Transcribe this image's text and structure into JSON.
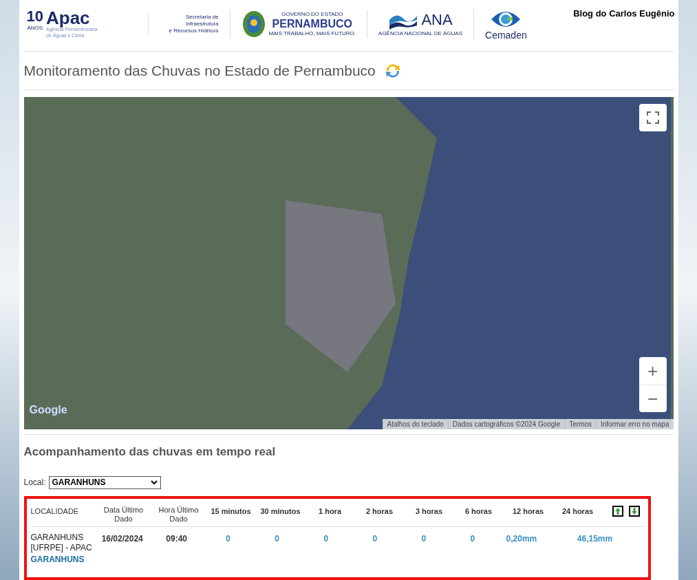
{
  "header": {
    "logos": [
      {
        "kind": "apac",
        "anniversary": "10",
        "anniversary_sub": "ANOS",
        "name": "Apac",
        "subtitle": "Agência Pernambucana de Águas e Clima"
      },
      {
        "kind": "secretaria",
        "lines": [
          "Secretaria de",
          "Infraestrutura",
          "e Recursos Hídricos"
        ]
      },
      {
        "kind": "state",
        "top": "GOVERNO DO ESTADO",
        "name": "PERNAMBUCO",
        "slogan": "MAIS TRABALHO, MAIS FUTURO."
      },
      {
        "kind": "ana",
        "name": "ANA",
        "subtitle": "AGÊNCIA NACIONAL DE ÁGUAS"
      },
      {
        "kind": "cemaden",
        "name": "Cemaden"
      }
    ],
    "blog": "Blog do Carlos Eugênio"
  },
  "title": "Monitoramento das Chuvas no Estado de Pernambuco",
  "map": {
    "google": "Google",
    "attribution": [
      "Atalhos do teclado",
      "Dados cartográficos ©2024 Google",
      "Termos",
      "Informar erro no mapa"
    ],
    "zoom_in": "+",
    "zoom_out": "−"
  },
  "section_title": "Acompanhamento das chuvas em tempo real",
  "local": {
    "label": "Local:",
    "value": "GARANHUNS"
  },
  "table": {
    "columns": [
      "LOCALIDADE",
      "Data Último Dado",
      "Hora Último Dado",
      "15 minutos",
      "30 minutos",
      "1 hora",
      "2 horas",
      "3 horas",
      "6 horas",
      "12 horas",
      "24 horas"
    ],
    "rows": [
      {
        "station": "GARANHUNS [UFRPE] - APAC",
        "city": "GARANHUNS",
        "date": "16/02/2024",
        "time": "09:40",
        "values": [
          "0",
          "0",
          "0",
          "0",
          "0",
          "0",
          "0,20mm",
          "46,15mm"
        ]
      }
    ]
  }
}
